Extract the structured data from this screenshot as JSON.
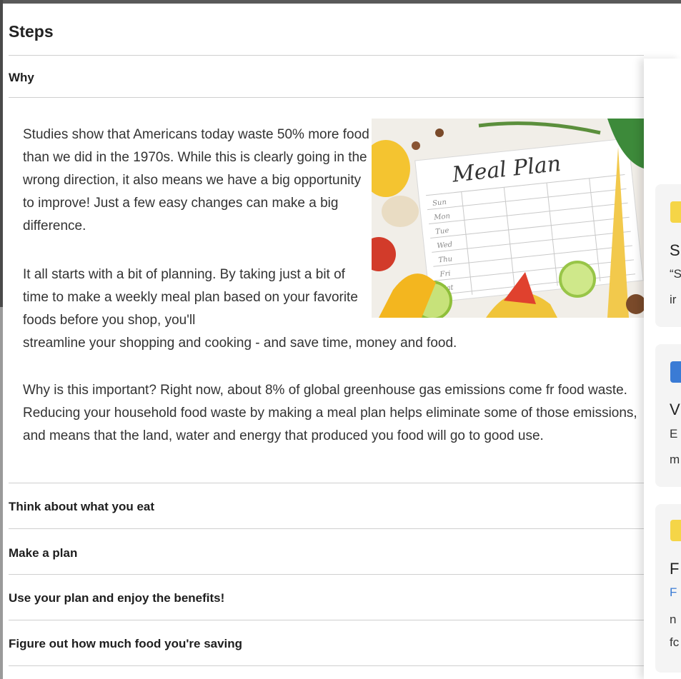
{
  "steps": {
    "title": "Steps",
    "sections": [
      {
        "label": "Why"
      },
      {
        "label": "Think about what you eat"
      },
      {
        "label": "Make a plan"
      },
      {
        "label": "Use your plan and enjoy the benefits!"
      },
      {
        "label": "Figure out how much food you're saving"
      }
    ]
  },
  "why": {
    "paragraph1": "Studies show that Americans today waste 50% more food than we did in the 1970s. While this is clearly going in the wrong direction, it also means we have a big opportunity to improve!  Just a few easy changes can make a big difference.",
    "paragraph2_wrapped": "It all starts with a bit of planning. By taking just a bit of time to make a weekly meal plan based on your favorite foods before you shop, you'll",
    "paragraph2_tail": "streamline your shopping and cooking - and save time, money and food.",
    "paragraph3": "Why is this important? Right now, about 8% of global greenhouse gas emissions come fr food waste. Reducing your household food waste by making a meal plan helps eliminate some of those emissions, and means that the land, water and energy that produced you food will go to good use.",
    "image": {
      "title": "Meal Plan",
      "days": [
        "Sun",
        "Mon",
        "Tue",
        "Wed",
        "Thu",
        "Fri",
        "Sat"
      ]
    }
  },
  "side_panel": {
    "cards": [
      {
        "badge_color": "#f5d547",
        "heading": "S",
        "lines": [
          "“S",
          "ir"
        ]
      },
      {
        "badge_color": "#3a7bd5",
        "heading": "V",
        "lines": [
          "E",
          "m"
        ]
      },
      {
        "badge_color": "#f5d547",
        "heading": "F",
        "link": "F",
        "lines": [
          "n",
          "fc"
        ]
      }
    ]
  }
}
